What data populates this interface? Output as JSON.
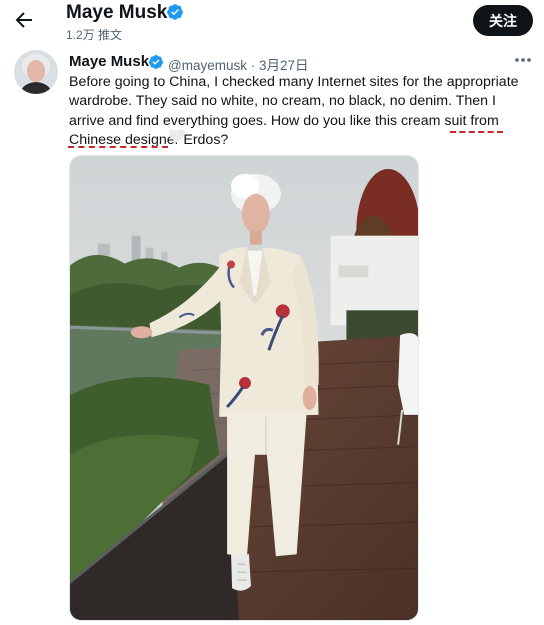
{
  "header": {
    "title": "Maye Musk",
    "post_count": "1.2万 推文",
    "follow_label": "关注"
  },
  "tweet": {
    "author_name": "Maye Musk",
    "handle_date": "@mayemusk · 3月27日",
    "text": "Before going to China, I checked many Internet sites for the appropriate wardrobe. They said no white, no cream, no black, no denim. Then I arrive and find everything goes. How do you like this cream suit from Chinese designer Erdos?"
  },
  "colors": {
    "verified": "#1d9bf0",
    "text_primary": "#0f1419",
    "text_secondary": "#536471",
    "annotation": "#c8262a",
    "button_bg": "#0f1419"
  },
  "icons": {
    "back": "back-arrow-icon",
    "verified": "verified-badge-icon",
    "more": "more-dots-icon",
    "heart": "heart-icon"
  }
}
